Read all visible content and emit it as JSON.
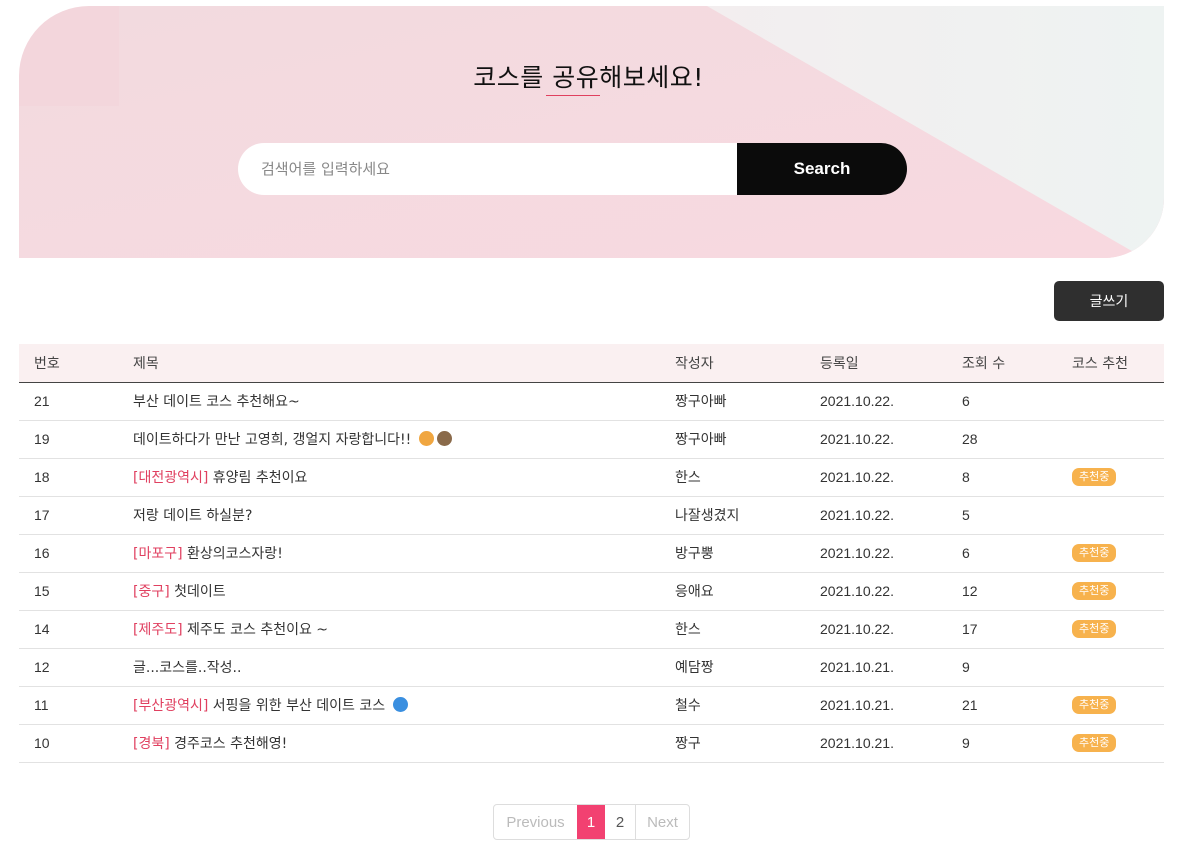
{
  "hero": {
    "title": "코스를 공유해보세요!"
  },
  "search": {
    "placeholder": "검색어를 입력하세요",
    "button_label": "Search"
  },
  "write_button_label": "글쓰기",
  "table": {
    "headers": [
      "번호",
      "제목",
      "작성자",
      "등록일",
      "조회 수",
      "코스 추천"
    ],
    "rows": [
      {
        "no": "21",
        "region": "",
        "title": "부산 데이트 코스 추천해요~",
        "author": "짱구아빠",
        "date": "2021.10.22.",
        "views": "6",
        "badge": ""
      },
      {
        "no": "19",
        "region": "",
        "title": "데이트하다가 만난 고영희, 갱얼지 자랑합니다!! ",
        "author": "짱구아빠",
        "date": "2021.10.22.",
        "views": "28",
        "badge": ""
      },
      {
        "no": "18",
        "region": "[대전광역시]",
        "title": " 휴양림 추천이요",
        "author": "한스",
        "date": "2021.10.22.",
        "views": "8",
        "badge": "추천중"
      },
      {
        "no": "17",
        "region": "",
        "title": "저랑 데이트 하실분?",
        "author": "나잘생겼지",
        "date": "2021.10.22.",
        "views": "5",
        "badge": ""
      },
      {
        "no": "16",
        "region": "[마포구]",
        "title": " 환상의코스자랑!",
        "author": "방구뿡",
        "date": "2021.10.22.",
        "views": "6",
        "badge": "추천중"
      },
      {
        "no": "15",
        "region": "[중구]",
        "title": " 첫데이트",
        "author": "응애요",
        "date": "2021.10.22.",
        "views": "12",
        "badge": "추천중"
      },
      {
        "no": "14",
        "region": "[제주도]",
        "title": " 제주도 코스 추천이요 ~",
        "author": "한스",
        "date": "2021.10.22.",
        "views": "17",
        "badge": "추천중"
      },
      {
        "no": "12",
        "region": "",
        "title": "글...코스를..작성..",
        "author": "예담짱",
        "date": "2021.10.21.",
        "views": "9",
        "badge": ""
      },
      {
        "no": "11",
        "region": "[부산광역시]",
        "title": " 서핑을 위한 부산 데이트 코스 ",
        "author": "철수",
        "date": "2021.10.21.",
        "views": "21",
        "badge": "추천중"
      },
      {
        "no": "10",
        "region": "[경북]",
        "title": " 경주코스 추천해영!",
        "author": "짱구",
        "date": "2021.10.21.",
        "views": "9",
        "badge": "추천중"
      }
    ]
  },
  "pagination": {
    "prev": "Previous",
    "pages": [
      "1",
      "2"
    ],
    "current": "1",
    "next": "Next"
  },
  "colors": {
    "accent": "#f24171",
    "badge": "#f7b24d",
    "region": "#e04060",
    "hero_pink": "#f3d7dd"
  }
}
